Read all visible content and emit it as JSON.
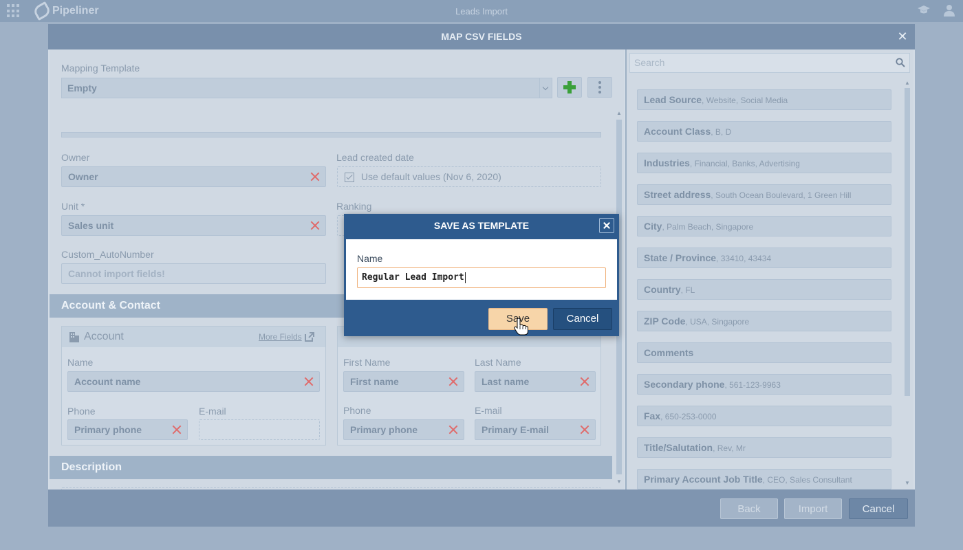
{
  "app": {
    "brand": "Pipeliner",
    "page_title": "Leads Import"
  },
  "modal": {
    "title": "MAP CSV FIELDS",
    "mapping_template_label": "Mapping Template",
    "mapping_template_value": "Empty",
    "fields": {
      "owner_label": "Owner",
      "owner_value": "Owner",
      "lead_created_label": "Lead created date",
      "lead_created_value": "Use default values (Nov 6, 2020)",
      "unit_label": "Unit *",
      "unit_value": "Sales unit",
      "ranking_label": "Ranking",
      "custom_label": "Custom_AutoNumber",
      "custom_value": "Cannot import fields!"
    },
    "account_contact": {
      "section_title": "Account & Contact",
      "account_title": "Account",
      "more_fields": "More Fields",
      "name_label": "Name",
      "name_value": "Account name",
      "phone_label": "Phone",
      "phone_value": "Primary phone",
      "email_label": "E-mail",
      "first_name_label": "First Name",
      "first_name_value": "First name",
      "last_name_label": "Last Name",
      "last_name_value": "Last name",
      "contact_phone_label": "Phone",
      "contact_phone_value": "Primary phone",
      "contact_email_label": "E-mail",
      "contact_email_value": "Primary E-mail"
    },
    "description": {
      "section_title": "Description"
    },
    "search_placeholder": "Search",
    "csv_columns": [
      {
        "name": "Lead Source",
        "examples": ", Website, Social Media"
      },
      {
        "name": "Account Class",
        "examples": ", B, D"
      },
      {
        "name": "Industries",
        "examples": ", Financial, Banks, Advertising"
      },
      {
        "name": "Street address",
        "examples": ", South Ocean Boulevard, 1 Green Hill"
      },
      {
        "name": "City",
        "examples": ", Palm Beach, Singapore"
      },
      {
        "name": "State / Province",
        "examples": ", 33410, 43434"
      },
      {
        "name": "Country",
        "examples": ", FL"
      },
      {
        "name": "ZIP Code",
        "examples": ", USA, Singapore"
      },
      {
        "name": "Comments",
        "examples": ""
      },
      {
        "name": "Secondary phone",
        "examples": ", 561-123-9963"
      },
      {
        "name": "Fax",
        "examples": ", 650-253-0000"
      },
      {
        "name": "Title/Salutation",
        "examples": ", Rev, Mr"
      },
      {
        "name": "Primary Account Job Title",
        "examples": ", CEO, Sales Consultant"
      }
    ],
    "footer": {
      "back": "Back",
      "import": "Import",
      "cancel": "Cancel"
    }
  },
  "dialog": {
    "title": "SAVE AS TEMPLATE",
    "name_label": "Name",
    "name_value": "Regular Lead Import",
    "save": "Save",
    "cancel": "Cancel"
  },
  "colors": {
    "dialog_bg": "#2e5b8e",
    "save_button": "#f7d5a9",
    "input_border_focus": "#f0b078",
    "remove_x": "#e06a6a",
    "add_plus": "#3aa03a"
  }
}
